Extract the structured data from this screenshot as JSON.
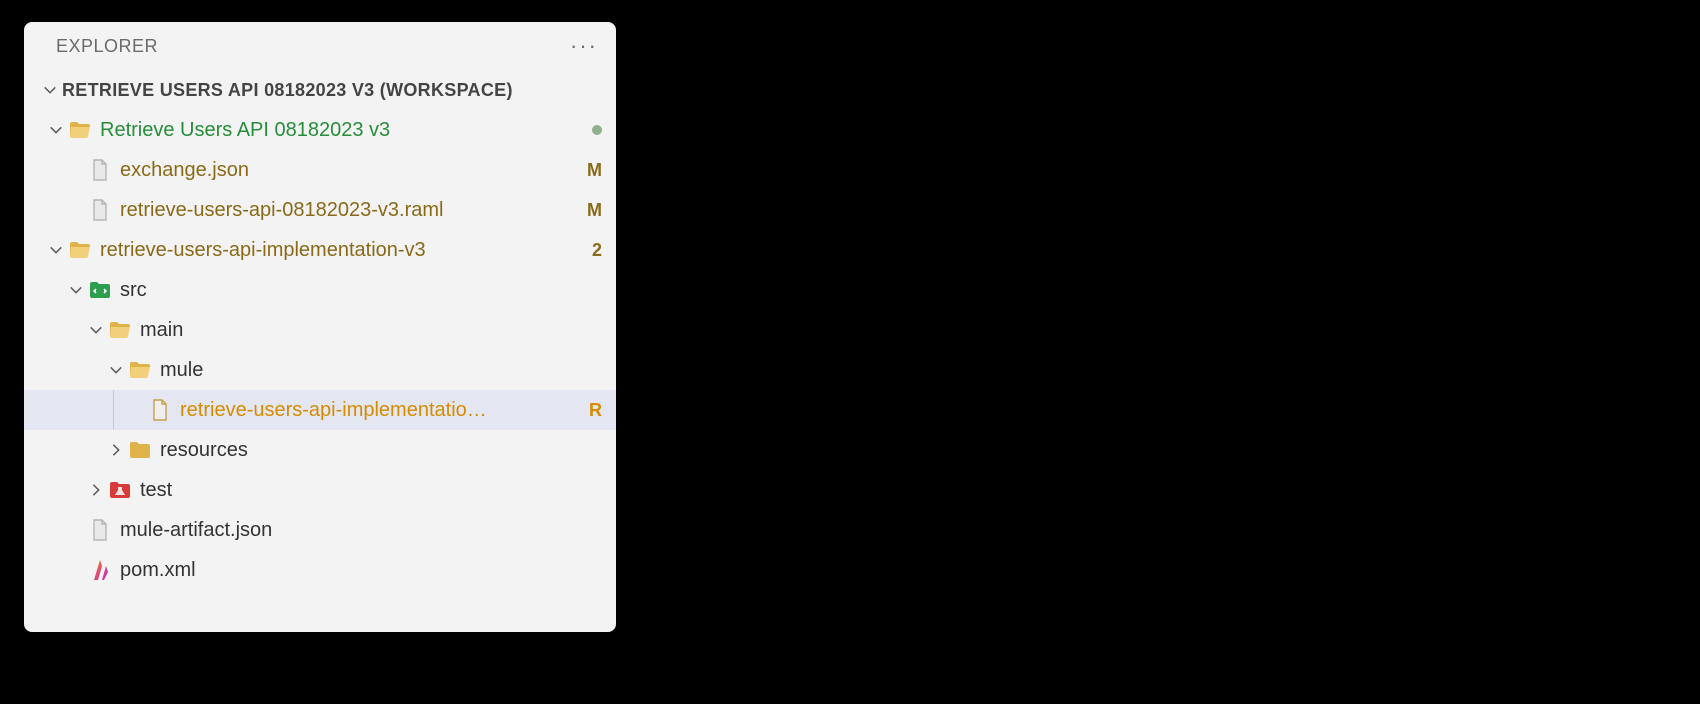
{
  "header": {
    "title": "EXPLORER"
  },
  "section": {
    "title": "RETRIEVE USERS API 08182023 V3 (WORKSPACE)"
  },
  "tree": {
    "project1": {
      "label": "Retrieve Users API 08182023 v3",
      "status": "dot"
    },
    "file_exchange": {
      "label": "exchange.json",
      "badge": "M"
    },
    "file_raml": {
      "label": "retrieve-users-api-08182023-v3.raml",
      "badge": "M"
    },
    "project2": {
      "label": "retrieve-users-api-implementation-v3",
      "badge": "2"
    },
    "folder_src": {
      "label": "src"
    },
    "folder_main": {
      "label": "main"
    },
    "folder_mule": {
      "label": "mule"
    },
    "file_impl": {
      "label": "retrieve-users-api-implementatio…",
      "badge": "R"
    },
    "folder_resources": {
      "label": "resources"
    },
    "folder_test": {
      "label": "test"
    },
    "file_artifact": {
      "label": "mule-artifact.json"
    },
    "file_pom": {
      "label": "pom.xml"
    }
  }
}
